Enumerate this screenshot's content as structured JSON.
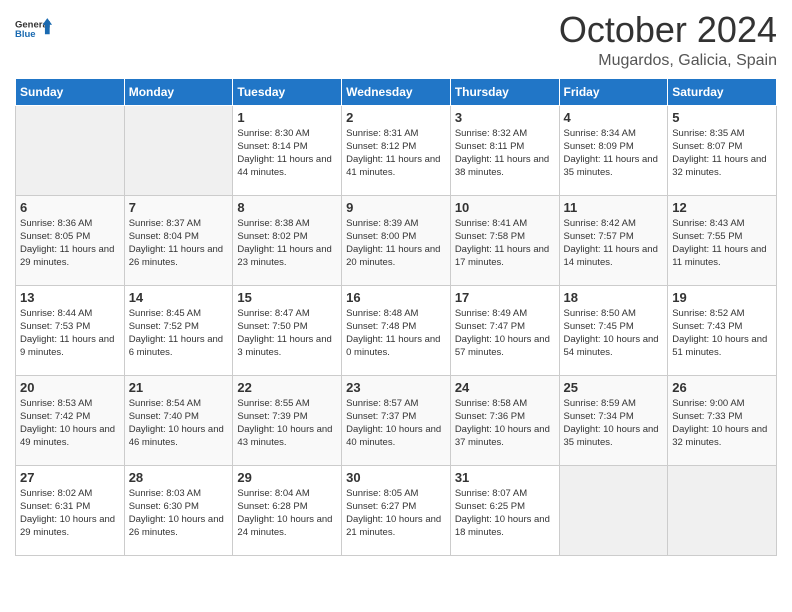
{
  "logo": {
    "line1": "General",
    "line2": "Blue"
  },
  "title": "October 2024",
  "location": "Mugardos, Galicia, Spain",
  "headers": [
    "Sunday",
    "Monday",
    "Tuesday",
    "Wednesday",
    "Thursday",
    "Friday",
    "Saturday"
  ],
  "weeks": [
    [
      {
        "day": "",
        "info": ""
      },
      {
        "day": "",
        "info": ""
      },
      {
        "day": "1",
        "info": "Sunrise: 8:30 AM\nSunset: 8:14 PM\nDaylight: 11 hours and 44 minutes."
      },
      {
        "day": "2",
        "info": "Sunrise: 8:31 AM\nSunset: 8:12 PM\nDaylight: 11 hours and 41 minutes."
      },
      {
        "day": "3",
        "info": "Sunrise: 8:32 AM\nSunset: 8:11 PM\nDaylight: 11 hours and 38 minutes."
      },
      {
        "day": "4",
        "info": "Sunrise: 8:34 AM\nSunset: 8:09 PM\nDaylight: 11 hours and 35 minutes."
      },
      {
        "day": "5",
        "info": "Sunrise: 8:35 AM\nSunset: 8:07 PM\nDaylight: 11 hours and 32 minutes."
      }
    ],
    [
      {
        "day": "6",
        "info": "Sunrise: 8:36 AM\nSunset: 8:05 PM\nDaylight: 11 hours and 29 minutes."
      },
      {
        "day": "7",
        "info": "Sunrise: 8:37 AM\nSunset: 8:04 PM\nDaylight: 11 hours and 26 minutes."
      },
      {
        "day": "8",
        "info": "Sunrise: 8:38 AM\nSunset: 8:02 PM\nDaylight: 11 hours and 23 minutes."
      },
      {
        "day": "9",
        "info": "Sunrise: 8:39 AM\nSunset: 8:00 PM\nDaylight: 11 hours and 20 minutes."
      },
      {
        "day": "10",
        "info": "Sunrise: 8:41 AM\nSunset: 7:58 PM\nDaylight: 11 hours and 17 minutes."
      },
      {
        "day": "11",
        "info": "Sunrise: 8:42 AM\nSunset: 7:57 PM\nDaylight: 11 hours and 14 minutes."
      },
      {
        "day": "12",
        "info": "Sunrise: 8:43 AM\nSunset: 7:55 PM\nDaylight: 11 hours and 11 minutes."
      }
    ],
    [
      {
        "day": "13",
        "info": "Sunrise: 8:44 AM\nSunset: 7:53 PM\nDaylight: 11 hours and 9 minutes."
      },
      {
        "day": "14",
        "info": "Sunrise: 8:45 AM\nSunset: 7:52 PM\nDaylight: 11 hours and 6 minutes."
      },
      {
        "day": "15",
        "info": "Sunrise: 8:47 AM\nSunset: 7:50 PM\nDaylight: 11 hours and 3 minutes."
      },
      {
        "day": "16",
        "info": "Sunrise: 8:48 AM\nSunset: 7:48 PM\nDaylight: 11 hours and 0 minutes."
      },
      {
        "day": "17",
        "info": "Sunrise: 8:49 AM\nSunset: 7:47 PM\nDaylight: 10 hours and 57 minutes."
      },
      {
        "day": "18",
        "info": "Sunrise: 8:50 AM\nSunset: 7:45 PM\nDaylight: 10 hours and 54 minutes."
      },
      {
        "day": "19",
        "info": "Sunrise: 8:52 AM\nSunset: 7:43 PM\nDaylight: 10 hours and 51 minutes."
      }
    ],
    [
      {
        "day": "20",
        "info": "Sunrise: 8:53 AM\nSunset: 7:42 PM\nDaylight: 10 hours and 49 minutes."
      },
      {
        "day": "21",
        "info": "Sunrise: 8:54 AM\nSunset: 7:40 PM\nDaylight: 10 hours and 46 minutes."
      },
      {
        "day": "22",
        "info": "Sunrise: 8:55 AM\nSunset: 7:39 PM\nDaylight: 10 hours and 43 minutes."
      },
      {
        "day": "23",
        "info": "Sunrise: 8:57 AM\nSunset: 7:37 PM\nDaylight: 10 hours and 40 minutes."
      },
      {
        "day": "24",
        "info": "Sunrise: 8:58 AM\nSunset: 7:36 PM\nDaylight: 10 hours and 37 minutes."
      },
      {
        "day": "25",
        "info": "Sunrise: 8:59 AM\nSunset: 7:34 PM\nDaylight: 10 hours and 35 minutes."
      },
      {
        "day": "26",
        "info": "Sunrise: 9:00 AM\nSunset: 7:33 PM\nDaylight: 10 hours and 32 minutes."
      }
    ],
    [
      {
        "day": "27",
        "info": "Sunrise: 8:02 AM\nSunset: 6:31 PM\nDaylight: 10 hours and 29 minutes."
      },
      {
        "day": "28",
        "info": "Sunrise: 8:03 AM\nSunset: 6:30 PM\nDaylight: 10 hours and 26 minutes."
      },
      {
        "day": "29",
        "info": "Sunrise: 8:04 AM\nSunset: 6:28 PM\nDaylight: 10 hours and 24 minutes."
      },
      {
        "day": "30",
        "info": "Sunrise: 8:05 AM\nSunset: 6:27 PM\nDaylight: 10 hours and 21 minutes."
      },
      {
        "day": "31",
        "info": "Sunrise: 8:07 AM\nSunset: 6:25 PM\nDaylight: 10 hours and 18 minutes."
      },
      {
        "day": "",
        "info": ""
      },
      {
        "day": "",
        "info": ""
      }
    ]
  ]
}
